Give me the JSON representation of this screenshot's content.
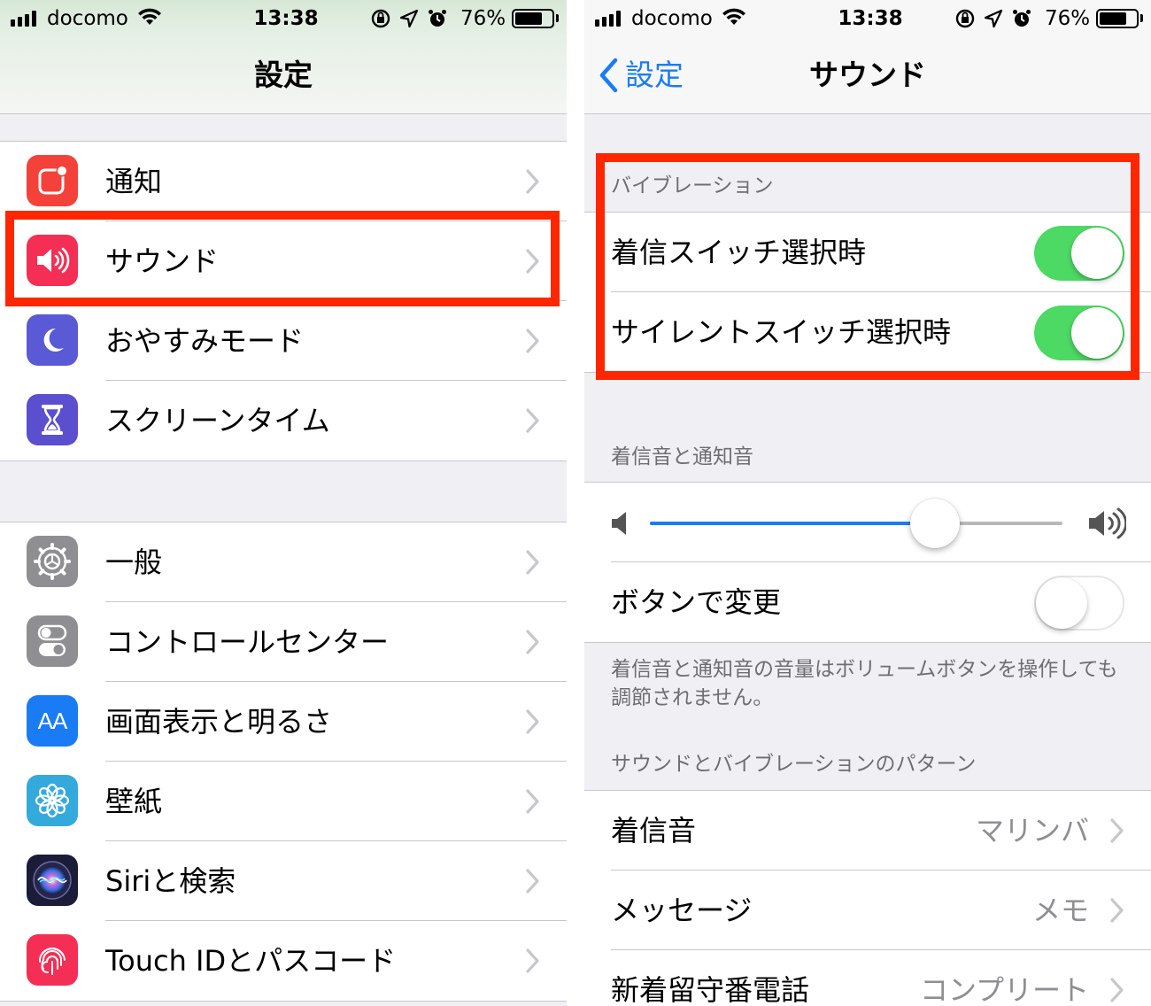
{
  "status_bar": {
    "carrier": "docomo",
    "time": "13:38",
    "battery": "76%",
    "battery_level": 0.76
  },
  "left": {
    "nav_title": "設定",
    "group1": [
      {
        "label": "通知",
        "icon": "notifications-icon",
        "color": "#f4423a"
      },
      {
        "label": "サウンド",
        "icon": "speaker-icon",
        "color": "#f42e54"
      },
      {
        "label": "おやすみモード",
        "icon": "moon-icon",
        "color": "#5a5ad6"
      },
      {
        "label": "スクリーンタイム",
        "icon": "hourglass-icon",
        "color": "#5b4fd0"
      }
    ],
    "group2": [
      {
        "label": "一般",
        "icon": "gear-icon",
        "color": "#8e8e93"
      },
      {
        "label": "コントロールセンター",
        "icon": "toggles-icon",
        "color": "#8e8e93"
      },
      {
        "label": "画面表示と明るさ",
        "icon": "text-size-icon",
        "icon_text": "AA",
        "color": "#1a7cf5"
      },
      {
        "label": "壁紙",
        "icon": "flower-icon",
        "color": "#34aadc"
      },
      {
        "label": "Siriと検索",
        "icon": "siri-icon",
        "color": "#1b1b3a"
      },
      {
        "label": "Touch IDとパスコード",
        "icon": "fingerprint-icon",
        "color": "#f42e54"
      }
    ]
  },
  "right": {
    "back_label": "設定",
    "nav_title": "サウンド",
    "vibration": {
      "header": "バイブレーション",
      "rows": [
        {
          "label": "着信スイッチ選択時",
          "on": true
        },
        {
          "label": "サイレントスイッチ選択時",
          "on": true
        }
      ]
    },
    "ringer": {
      "header": "着信音と通知音",
      "volume": 0.69,
      "change_with_buttons_label": "ボタンで変更",
      "change_with_buttons_on": false,
      "footer": "着信音と通知音の音量はボリュームボタンを操作しても調節されません。"
    },
    "patterns": {
      "header": "サウンドとバイブレーションのパターン",
      "rows": [
        {
          "label": "着信音",
          "value": "マリンバ"
        },
        {
          "label": "メッセージ",
          "value": "メモ"
        },
        {
          "label": "新着留守番電話",
          "value": "コンプリート"
        }
      ]
    }
  },
  "colors": {
    "accent": "#1a7cf5",
    "toggle_on": "#4cd964",
    "highlight": "#ff2600"
  }
}
